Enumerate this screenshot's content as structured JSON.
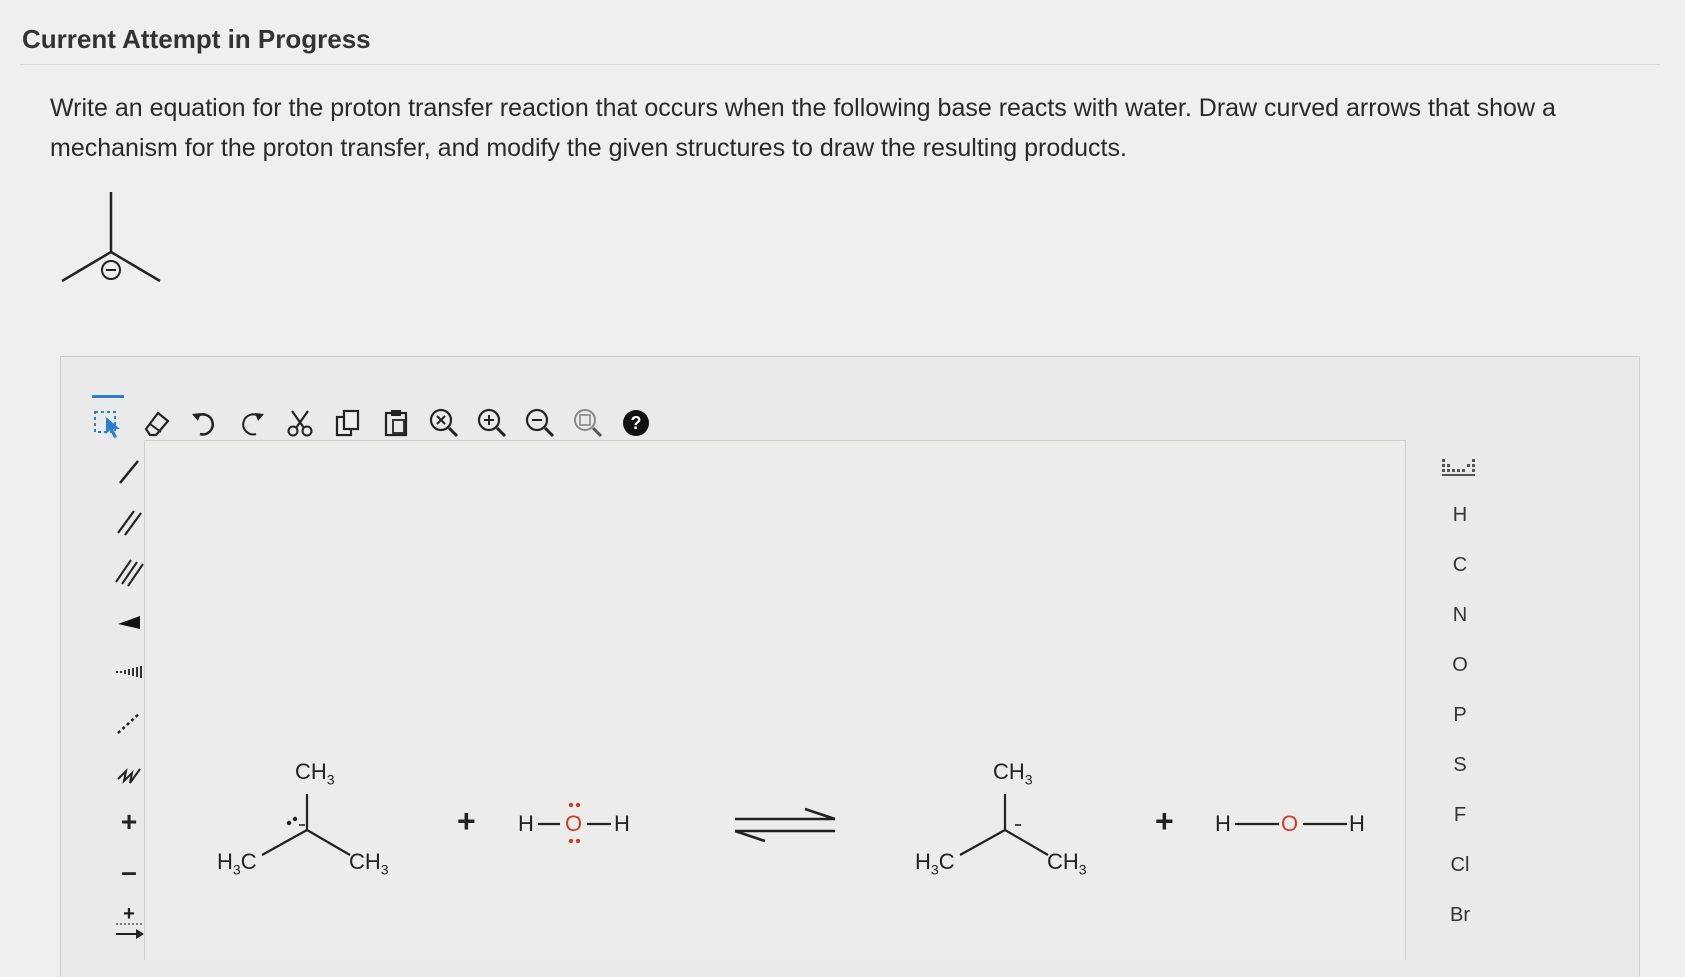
{
  "header": {
    "title": "Current Attempt in Progress"
  },
  "question": {
    "text": "Write an equation for the proton transfer reaction that occurs when the following base reacts with water. Draw curved arrows that show a mechanism for the proton transfer, and modify the given structures to draw the resulting products."
  },
  "toolbar": {
    "tools": [
      "select-icon",
      "eraser-icon",
      "undo-icon",
      "redo-icon",
      "cut-icon",
      "copy-icon",
      "paste-icon",
      "zoom-clear-icon",
      "zoom-in-icon",
      "zoom-out-icon",
      "zoom-fit-icon",
      "help-icon"
    ]
  },
  "left_tools": {
    "bonds": [
      "single-bond-icon",
      "double-bond-icon",
      "triple-bond-icon",
      "wedge-bond-icon",
      "hash-bond-icon",
      "dashed-bond-icon",
      "wavy-bond-icon"
    ],
    "plus_label": "+",
    "minus_label": "–"
  },
  "elements": [
    "H",
    "C",
    "N",
    "O",
    "P",
    "S",
    "F",
    "Cl",
    "Br"
  ],
  "equation": {
    "reactant": {
      "top": "CH",
      "top_sub": "3",
      "left": "H",
      "left_sub": "3",
      "left_tail": "C",
      "right": "CH",
      "right_sub": "3"
    },
    "water_reactant": {
      "h1": "H",
      "o": "O",
      "h2": "H"
    },
    "plus": "+",
    "product": {
      "top": "CH",
      "top_sub": "3",
      "left": "H",
      "left_sub": "3",
      "left_tail": "C",
      "right": "CH",
      "right_sub": "3"
    },
    "water_product": {
      "h1": "H",
      "o": "O",
      "h2": "H"
    }
  },
  "colors": {
    "oxygen": "#d23b2a",
    "accent": "#2a7fd4"
  }
}
